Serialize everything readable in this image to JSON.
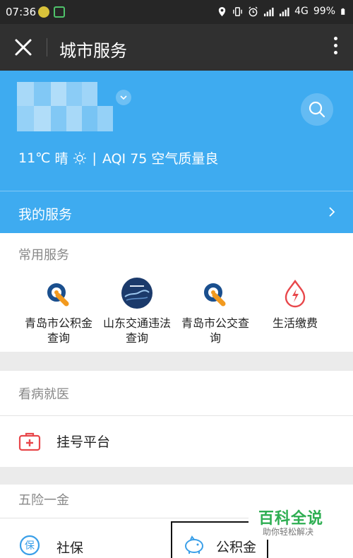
{
  "status_bar": {
    "time": "07:36",
    "network": "4G",
    "battery": "99%"
  },
  "title_bar": {
    "title": "城市服务"
  },
  "header": {
    "weather": {
      "temp": "11℃",
      "condition": "晴",
      "aqi": "AQI 75 空气质量良"
    },
    "my_services_label": "我的服务"
  },
  "common_services": {
    "title": "常用服务",
    "items": [
      {
        "line1": "青岛市公积金",
        "line2": "查询",
        "icon": "qingdao-logo-icon"
      },
      {
        "line1": "山东交通违法",
        "line2": "查询",
        "icon": "shandong-police-badge-icon"
      },
      {
        "line1": "青岛市公交查",
        "line2": "询",
        "icon": "qingdao-logo-icon"
      },
      {
        "line1": "生活缴费",
        "line2": "",
        "icon": "utility-bolt-icon"
      }
    ]
  },
  "medical": {
    "title": "看病就医",
    "row_label": "挂号平台"
  },
  "insurance": {
    "title": "五险一金",
    "left_label": "社保",
    "right_label": "公积金"
  },
  "watermark": {
    "big": "百科全说",
    "small": "助你轻松解决"
  },
  "colors": {
    "accent_blue": "#3eabf0",
    "title_bar": "#303030",
    "status_bar": "#262626",
    "medical_red": "#e8474b",
    "utility_red": "#e8474b",
    "insurance_blue": "#3a9fe8",
    "watermark_green": "#2eae52"
  }
}
